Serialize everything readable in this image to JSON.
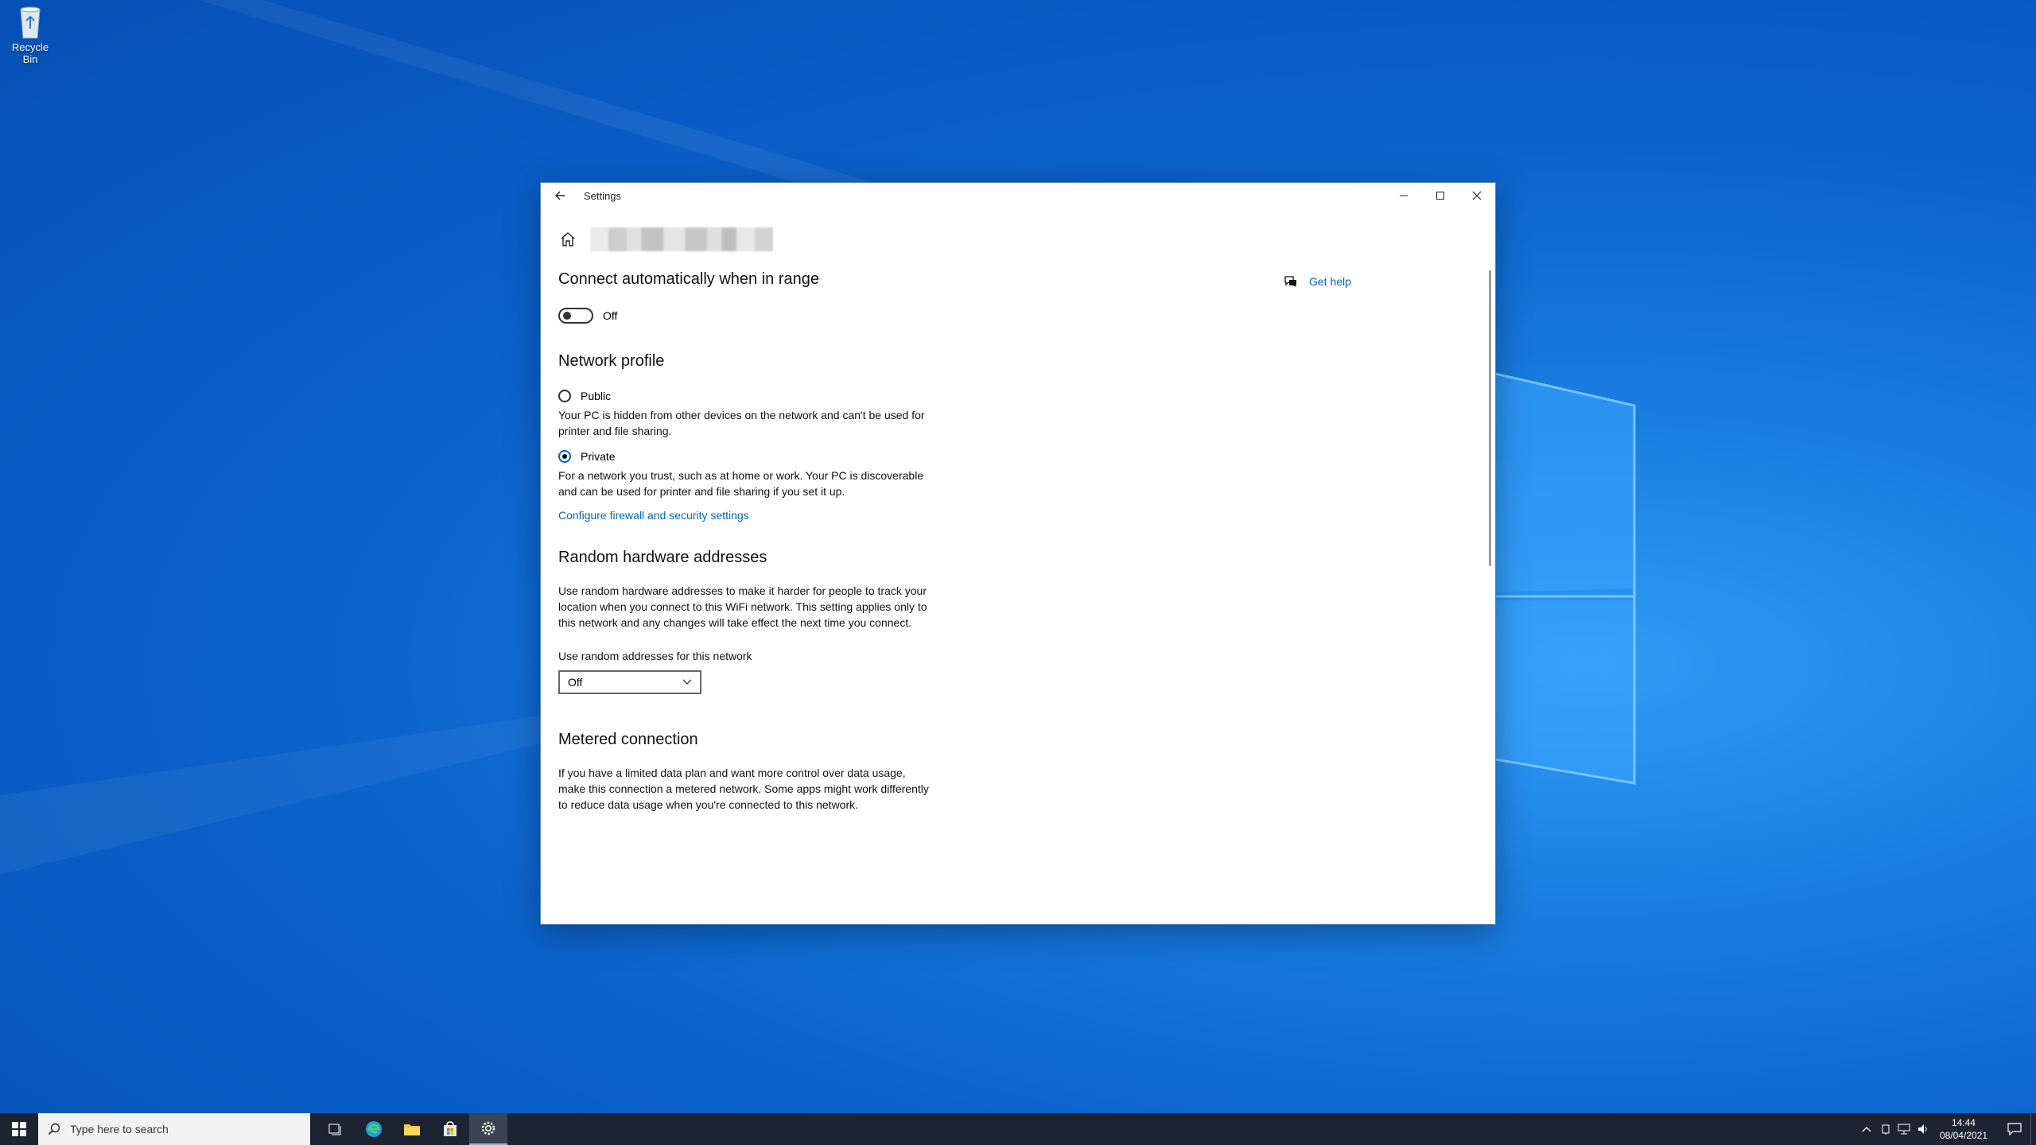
{
  "desktop": {
    "recycle_bin_label": "Recycle Bin"
  },
  "window": {
    "title": "Settings",
    "controls": {
      "minimize": "–",
      "maximize": "☐",
      "close": "✕"
    }
  },
  "help": {
    "label": "Get help"
  },
  "sections": {
    "connect": {
      "title": "Connect automatically when in range",
      "toggle_state": "Off"
    },
    "profile": {
      "title": "Network profile",
      "public_label": "Public",
      "public_desc": "Your PC is hidden from other devices on the network and can't be used for printer and file sharing.",
      "private_label": "Private",
      "private_desc": "For a network you trust, such as at home or work. Your PC is discoverable and can be used for printer and file sharing if you set it up.",
      "selected": "Private",
      "firewall_link": "Configure firewall and security settings"
    },
    "random": {
      "title": "Random hardware addresses",
      "desc": "Use random hardware addresses to make it harder for people to track your location when you connect to this WiFi network. This setting applies only to this network and any changes will take effect the next time you connect.",
      "field_label": "Use random addresses for this network",
      "selected_value": "Off"
    },
    "metered": {
      "title": "Metered connection",
      "desc": "If you have a limited data plan and want more control over data usage, make this connection a metered network. Some apps might work differently to reduce data usage when you're connected to this network."
    }
  },
  "taskbar": {
    "search_placeholder": "Type here to search",
    "time": "14:44",
    "date": "08/04/2021"
  },
  "colors": {
    "accent": "#0067c0",
    "taskbar": "#1c2431",
    "desktop": "#0b63cc"
  }
}
